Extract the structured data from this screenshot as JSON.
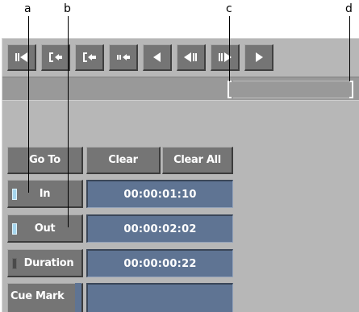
{
  "callouts": {
    "a": "a",
    "b": "b",
    "c": "c",
    "d": "d"
  },
  "transport": [
    {
      "name": "go-to-in-icon"
    },
    {
      "name": "go-to-mark-in-icon"
    },
    {
      "name": "go-to-mark-out-icon"
    },
    {
      "name": "go-to-out-icon"
    },
    {
      "name": "play-reverse-icon"
    },
    {
      "name": "step-back-icon"
    },
    {
      "name": "step-forward-icon"
    },
    {
      "name": "play-forward-icon"
    }
  ],
  "buttons": {
    "go_to": "Go To",
    "clear": "Clear",
    "clear_all": "Clear All"
  },
  "rows": {
    "in": {
      "label": "In",
      "value": "00:00:01:10",
      "indicator": "on"
    },
    "out": {
      "label": "Out",
      "value": "00:00:02:02",
      "indicator": "on"
    },
    "duration": {
      "label": "Duration",
      "value": "00:00:00:22",
      "indicator": "off"
    },
    "cue_mark": {
      "label": "Cue Mark",
      "value": ""
    }
  },
  "colors": {
    "panel": "#b7b7b7",
    "button": "#757575",
    "timecode_field": "#5f7493",
    "indicator_on": "#a6d6ee",
    "indicator_off": "#4a4a4a"
  }
}
